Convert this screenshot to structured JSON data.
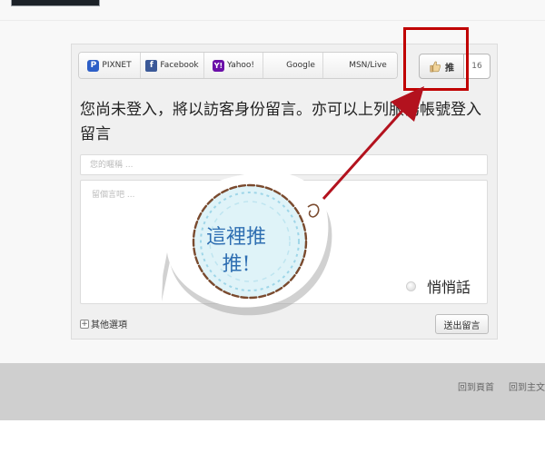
{
  "login_bar": {
    "providers": [
      {
        "label": "PIXNET",
        "icon": "pixnet-icon"
      },
      {
        "label": "Facebook",
        "icon": "facebook-icon"
      },
      {
        "label": "Yahoo!",
        "icon": "yahoo-icon"
      },
      {
        "label": "Google",
        "icon": "google-icon"
      },
      {
        "label": "MSN/Live",
        "icon": "msn-icon"
      }
    ]
  },
  "like": {
    "label": "推",
    "count": "16",
    "icon": "thumbs-up-icon"
  },
  "comment_form": {
    "login_prompt": "您尚未登入，將以訪客身份留言。亦可以上列服務帳號登入留言",
    "name_placeholder": "您的暱稱 ...",
    "message_placeholder": "留個言吧 ...",
    "private_label": "悄悄話",
    "more_options_label": "其他選項",
    "submit_label": "送出留言"
  },
  "sticker": {
    "text_line1": "這裡推",
    "text_line2": "推!"
  },
  "footer": {
    "links": [
      "回到頁首",
      "回到主文"
    ]
  },
  "colors": {
    "highlight": "#c00000",
    "sticker_text": "#2f6fb2",
    "footer_bg": "#cfcfcf"
  }
}
